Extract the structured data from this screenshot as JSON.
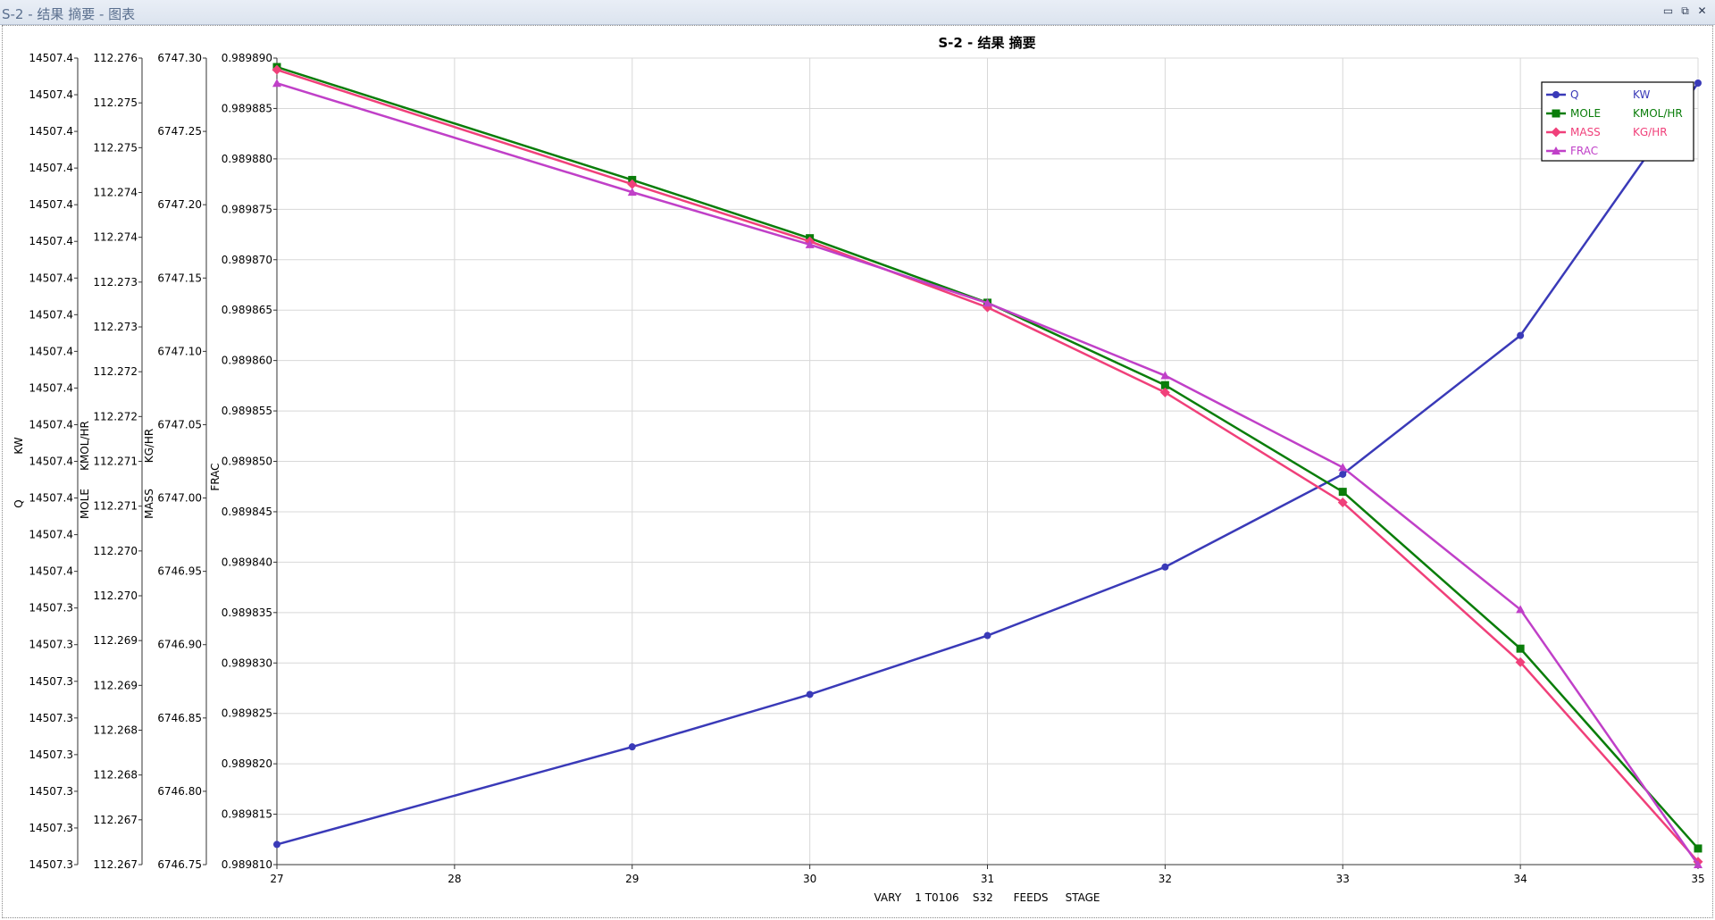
{
  "window": {
    "title": "S-2 - 结果 摘要 - 图表",
    "minimize_glyph": "▭",
    "restore_glyph": "⧉",
    "close_glyph": "✕"
  },
  "chart_data": {
    "type": "line",
    "title": "S-2 - 结果 摘要",
    "xlabel": "VARY    1 T0106    S32      FEEDS     STAGE",
    "x": [
      27,
      29,
      30,
      31,
      32,
      33,
      34,
      35
    ],
    "xlim": [
      27,
      35
    ],
    "xticks": [
      27,
      28,
      29,
      30,
      31,
      32,
      33,
      34,
      35
    ],
    "grid": true,
    "legend_position": "top-right",
    "axes": [
      {
        "id": "q",
        "label_top": "KW",
        "label_bottom": "Q",
        "ylim": [
          0,
          1
        ],
        "tick_labels": [
          "14507.4",
          "14507.4",
          "14507.4",
          "14507.4",
          "14507.4",
          "14507.4",
          "14507.4",
          "14507.4",
          "14507.4",
          "14507.4",
          "14507.4",
          "14507.4",
          "14507.4",
          "14507.4",
          "14507.4",
          "14507.3",
          "14507.3",
          "14507.3",
          "14507.3",
          "14507.3",
          "14507.3",
          "14507.3",
          "14507.3"
        ]
      },
      {
        "id": "mole",
        "label_top": "KMOL/HR",
        "label_bottom": "MOLE",
        "ylim": [
          112.267,
          112.276
        ],
        "tick_labels": [
          "112.276",
          "112.275",
          "112.275",
          "112.274",
          "112.274",
          "112.273",
          "112.273",
          "112.272",
          "112.272",
          "112.271",
          "112.271",
          "112.270",
          "112.270",
          "112.269",
          "112.269",
          "112.268",
          "112.268",
          "112.267",
          "112.267"
        ]
      },
      {
        "id": "mass",
        "label_top": "KG/HR",
        "label_bottom": "MASS",
        "ylim": [
          6746.75,
          6747.3
        ],
        "tick_labels": [
          "6747.30",
          "6747.25",
          "6747.20",
          "6747.15",
          "6747.10",
          "6747.05",
          "6747.00",
          "6746.95",
          "6746.90",
          "6746.85",
          "6746.80",
          "6746.75"
        ]
      },
      {
        "id": "frac",
        "label_top": "",
        "label_bottom": "FRAC",
        "ylim": [
          0.98981,
          0.98989
        ],
        "tick_labels": [
          "0.989890",
          "0.989885",
          "0.989880",
          "0.989875",
          "0.989870",
          "0.989865",
          "0.989860",
          "0.989855",
          "0.989850",
          "0.989845",
          "0.989840",
          "0.989835",
          "0.989830",
          "0.989825",
          "0.989820",
          "0.989815",
          "0.989810"
        ]
      }
    ],
    "series": [
      {
        "name": "Q",
        "unit": "KW",
        "axis": "q",
        "color": "#3a3ab8",
        "marker": "circle",
        "y": [
          0.025,
          0.146,
          0.211,
          0.284,
          0.369,
          0.484,
          0.656,
          0.969
        ]
      },
      {
        "name": "MOLE",
        "unit": "KMOL/HR",
        "axis": "mole",
        "color": "#0a7d0a",
        "marker": "square",
        "y": [
          112.2759,
          112.27464,
          112.27399,
          112.27327,
          112.27235,
          112.27116,
          112.26941,
          112.26718
        ]
      },
      {
        "name": "MASS",
        "unit": "KG/HR",
        "axis": "mass",
        "color": "#f0407a",
        "marker": "diamond",
        "y": [
          6747.292,
          6747.214,
          6747.175,
          6747.13,
          6747.072,
          6746.997,
          6746.888,
          6746.752
        ]
      },
      {
        "name": "FRAC",
        "unit": "",
        "axis": "frac",
        "color": "#c040c8",
        "marker": "triangle",
        "y": [
          0.9898875,
          0.9898767,
          0.9898715,
          0.9898657,
          0.9898585,
          0.9898494,
          0.9898353,
          0.98981
        ]
      }
    ]
  }
}
